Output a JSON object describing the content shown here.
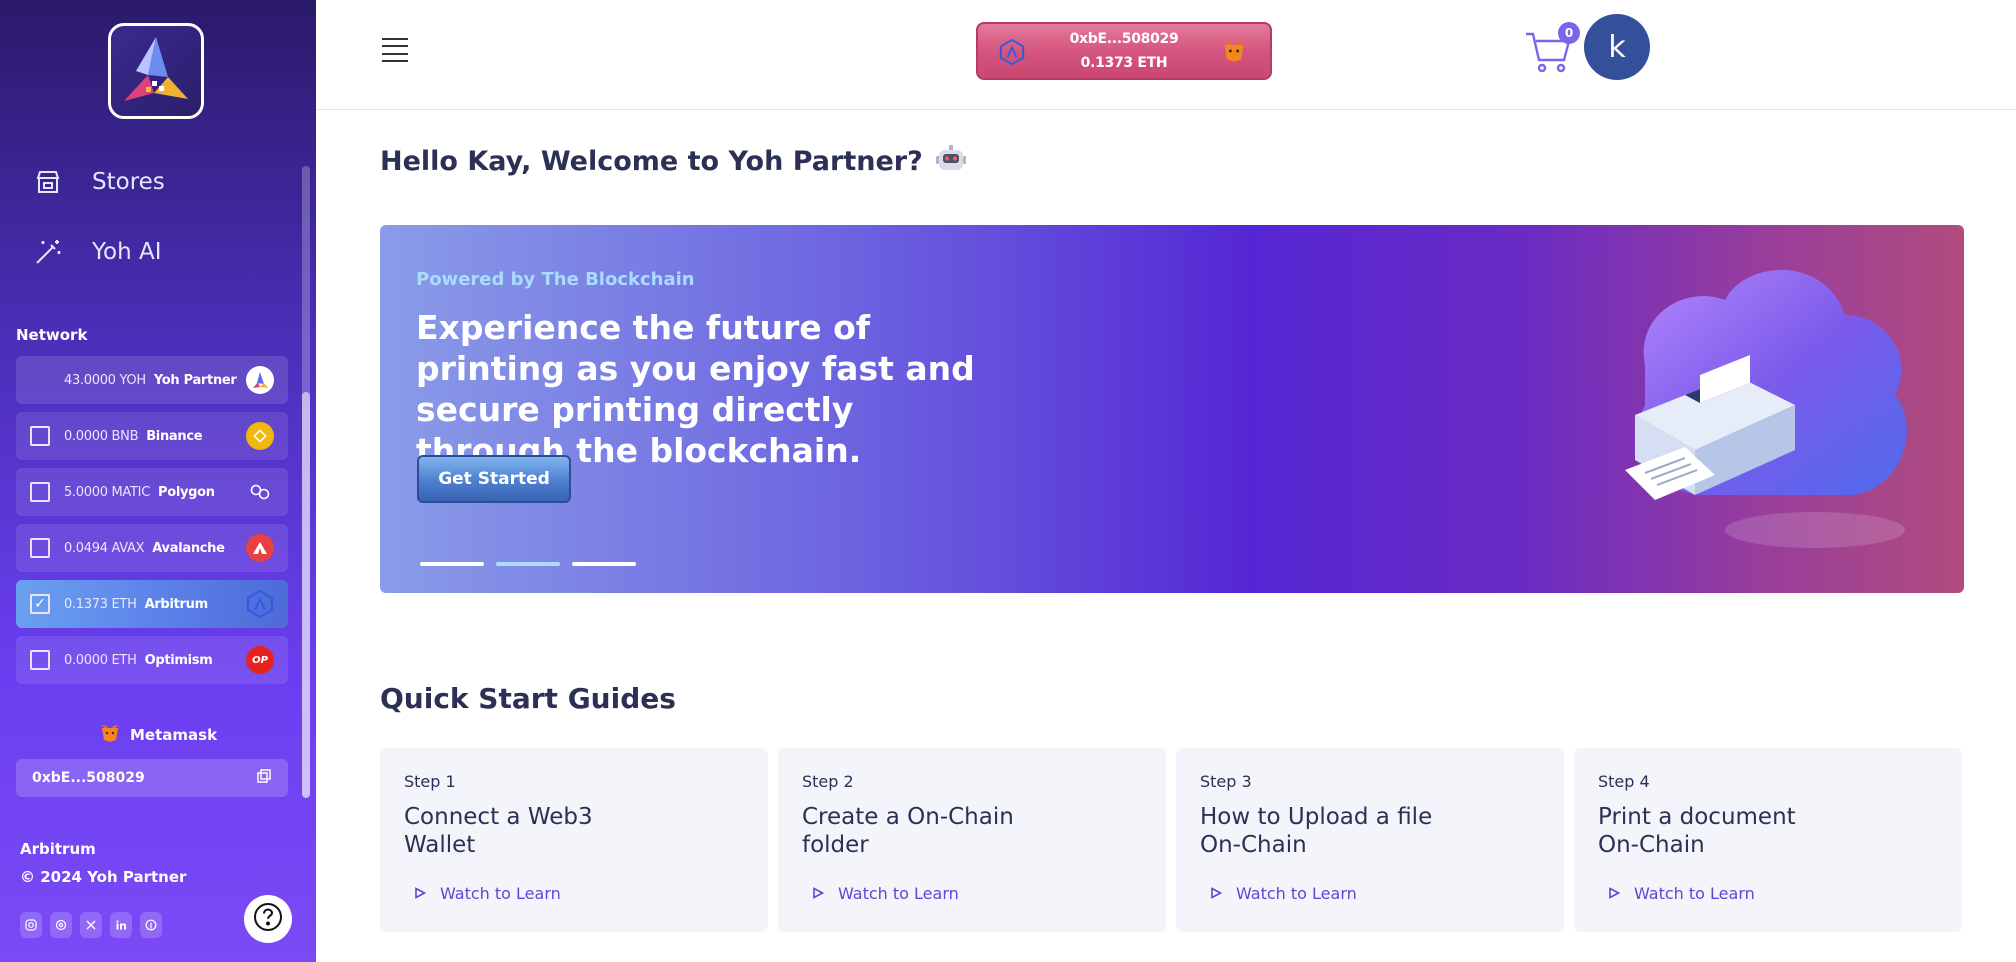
{
  "sidebar": {
    "nav": [
      {
        "label": "Stores",
        "icon": "store-icon"
      },
      {
        "label": "Yoh AI",
        "icon": "magic-wand-icon"
      }
    ],
    "network_label": "Network",
    "networks": [
      {
        "amount": "43.0000 YOH",
        "name": "Yoh Partner",
        "checked": false,
        "icon": "yoh-partner-icon"
      },
      {
        "amount": "0.0000 BNB",
        "name": "Binance",
        "checked": false,
        "icon": "binance-icon"
      },
      {
        "amount": "5.0000 MATIC",
        "name": "Polygon",
        "checked": false,
        "icon": "polygon-icon"
      },
      {
        "amount": "0.0494 AVAX",
        "name": "Avalanche",
        "checked": false,
        "icon": "avalanche-icon"
      },
      {
        "amount": "0.1373 ETH",
        "name": "Arbitrum",
        "checked": true,
        "icon": "arbitrum-icon"
      },
      {
        "amount": "0.0000 ETH",
        "name": "Optimism",
        "checked": false,
        "icon": "optimism-icon"
      }
    ],
    "optimism_badge": "OP",
    "wallet_name": "Metamask",
    "wallet_address": "0xbE...508029",
    "footer_chain": "Arbitrum",
    "footer_copy": "© 2024 Yoh Partner",
    "socials": [
      "instagram-icon",
      "threads-icon",
      "x-icon",
      "linkedin-icon",
      "pinterest-icon"
    ]
  },
  "header": {
    "wallet_address": "0xbE...508029",
    "wallet_balance": "0.1373 ETH",
    "cart_count": "0",
    "avatar_initial": "k"
  },
  "main": {
    "welcome": "Hello Kay, Welcome to Yoh Partner?",
    "welcome_emoji": "🤖",
    "hero": {
      "subtitle": "Powered by The Blockchain",
      "title": "Experience the future of printing as you enjoy fast and secure printing directly through the blockchain.",
      "button": "Get Started",
      "active_slide": 2,
      "slides": 3
    },
    "guides_title": "Quick Start Guides",
    "guides": [
      {
        "step": "Step 1",
        "title": "Connect a Web3 Wallet",
        "link": "Watch to Learn"
      },
      {
        "step": "Step 2",
        "title": "Create a On-Chain folder",
        "link": "Watch to Learn"
      },
      {
        "step": "Step 3",
        "title": "How to Upload a file On-Chain",
        "link": "Watch to Learn"
      },
      {
        "step": "Step 4",
        "title": "Print a document On-Chain",
        "link": "Watch to Learn"
      }
    ]
  },
  "colors": {
    "sidebar_top": "#2a1a6a",
    "sidebar_bottom": "#7b4af5",
    "accent": "#5b48d4",
    "avatar_bg": "#34509a",
    "wallet_pill": "#d4557e"
  }
}
